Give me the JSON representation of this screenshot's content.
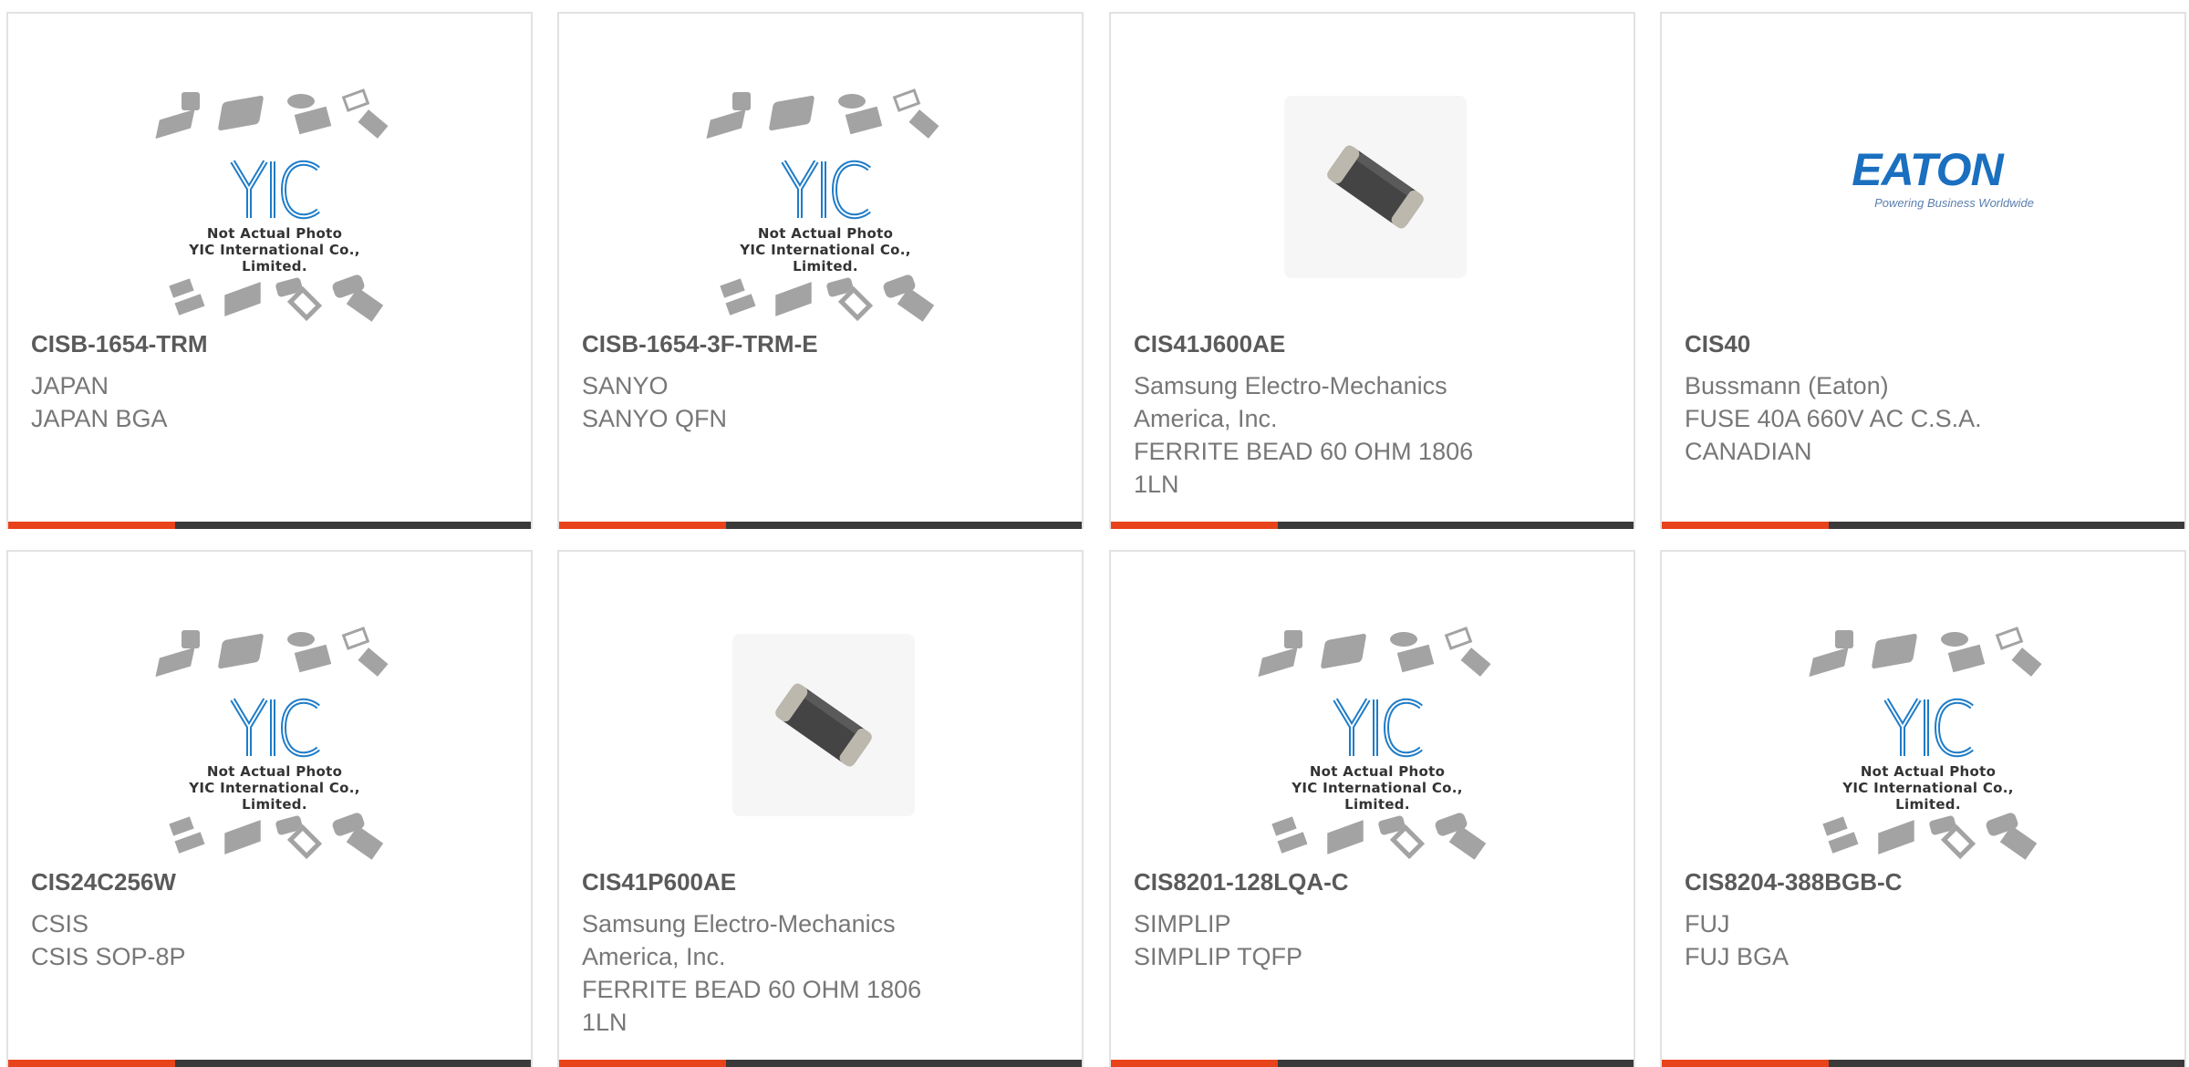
{
  "products": [
    {
      "part": "CISB-1654-TRM",
      "lines": [
        "JAPAN",
        "JAPAN BGA"
      ],
      "image": "yic-placeholder"
    },
    {
      "part": "CISB-1654-3F-TRM-E",
      "lines": [
        "SANYO",
        "SANYO QFN"
      ],
      "image": "yic-placeholder"
    },
    {
      "part": "CIS41J600AE",
      "lines": [
        "Samsung Electro-Mechanics",
        "America, Inc.",
        "FERRITE BEAD 60 OHM 1806",
        "1LN"
      ],
      "image": "ferrite-bead"
    },
    {
      "part": "CIS40",
      "lines": [
        "Bussmann (Eaton)",
        "FUSE 40A 660V AC C.S.A.",
        "CANADIAN"
      ],
      "image": "eaton-logo"
    },
    {
      "part": "CIS24C256W",
      "lines": [
        "CSIS",
        "CSIS SOP-8P"
      ],
      "image": "yic-placeholder"
    },
    {
      "part": "CIS41P600AE",
      "lines": [
        "Samsung Electro-Mechanics",
        "America, Inc.",
        "FERRITE BEAD 60 OHM 1806",
        "1LN"
      ],
      "image": "ferrite-bead"
    },
    {
      "part": "CIS8201-128LQA-C",
      "lines": [
        "SIMPLIP",
        "SIMPLIP TQFP"
      ],
      "image": "yic-placeholder"
    },
    {
      "part": "CIS8204-388BGB-C",
      "lines": [
        "FUJ",
        "FUJ BGA"
      ],
      "image": "yic-placeholder"
    }
  ],
  "placeholder": {
    "logo_text": "YIC",
    "caption1": "Not Actual Photo",
    "caption2": "YIC International Co., Limited."
  },
  "eaton": {
    "name": "EATON",
    "tagline": "Powering Business Worldwide"
  },
  "colors": {
    "accent": "#e8431b",
    "bar": "#3a3a3a",
    "eaton_blue": "#1a6fbf",
    "yic_blue": "#1e7cc8"
  }
}
